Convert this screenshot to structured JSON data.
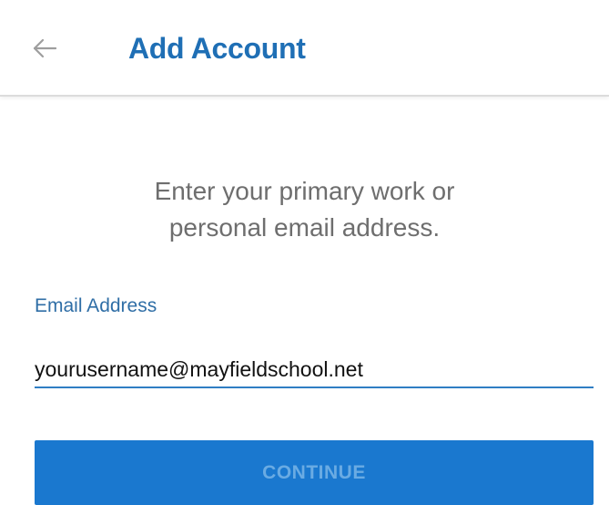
{
  "header": {
    "title": "Add Account",
    "back_icon": "arrow-left-icon"
  },
  "main": {
    "prompt_line1": "Enter your primary work or",
    "prompt_line2": "personal email address.",
    "email_label": "Email Address",
    "email_value": "yourusername@mayfieldschool.net",
    "continue_label": "CONTINUE"
  },
  "colors": {
    "accent": "#1f6fb5",
    "button_bg": "#1a78cf",
    "button_text_disabled": "#6aabe3",
    "prompt_text": "#6e6e6e",
    "input_underline": "#2f7ec4"
  }
}
